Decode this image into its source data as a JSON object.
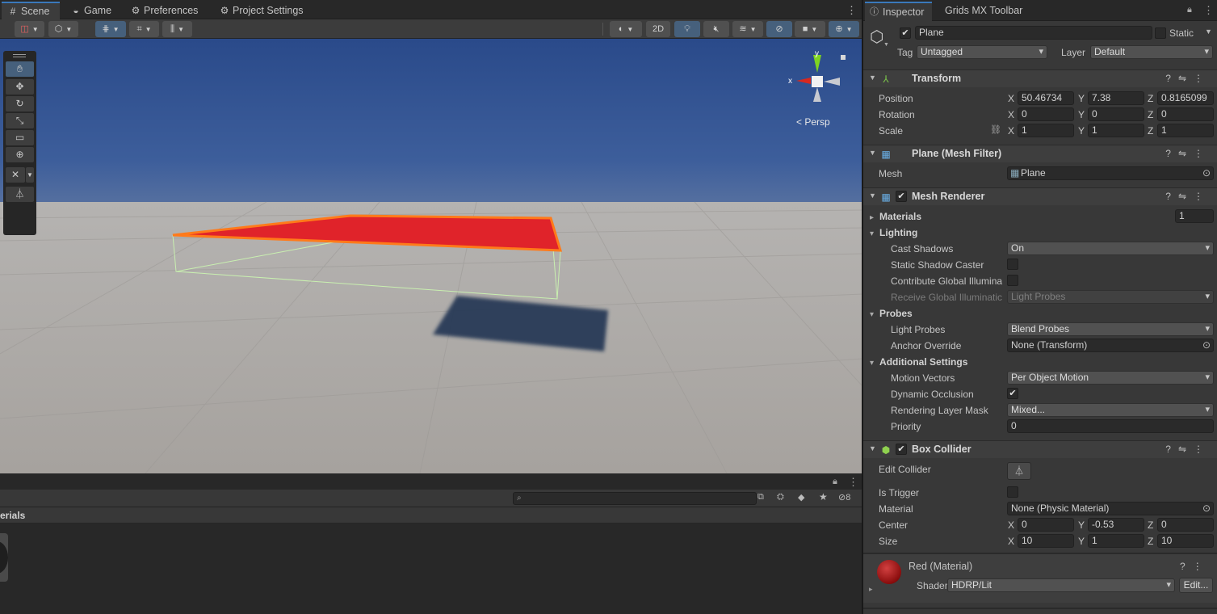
{
  "scene_tabs": [
    {
      "label": "Scene",
      "icon": "grid-icon"
    },
    {
      "label": "Game",
      "icon": "gamepad-icon"
    },
    {
      "label": "Preferences",
      "icon": "gear-icon"
    },
    {
      "label": "Project Settings",
      "icon": "gear-icon"
    }
  ],
  "scene_toolbar": {
    "two_d_label": "2D"
  },
  "scene_view": {
    "persp_label": "Persp",
    "gizmo": {
      "x": "x",
      "y": "y"
    }
  },
  "project_panel": {
    "search_placeholder": "",
    "breadcrumb": "erials",
    "hidden_count": "8"
  },
  "inspector": {
    "tabs": [
      "Inspector",
      "Grids MX Toolbar"
    ],
    "object": {
      "name": "Plane",
      "static_label": "Static",
      "active": true,
      "tag_label": "Tag",
      "tag_value": "Untagged",
      "layer_label": "Layer",
      "layer_value": "Default"
    },
    "transform": {
      "title": "Transform",
      "position_label": "Position",
      "position": {
        "x": "50.46734",
        "y": "7.38",
        "z": "0.8165099"
      },
      "rotation_label": "Rotation",
      "rotation": {
        "x": "0",
        "y": "0",
        "z": "0"
      },
      "scale_label": "Scale",
      "scale": {
        "x": "1",
        "y": "1",
        "z": "1"
      }
    },
    "mesh_filter": {
      "title": "Plane (Mesh Filter)",
      "mesh_label": "Mesh",
      "mesh_value": "Plane"
    },
    "mesh_renderer": {
      "title": "Mesh Renderer",
      "materials_label": "Materials",
      "materials_count": "1",
      "lighting_label": "Lighting",
      "cast_shadows_label": "Cast Shadows",
      "cast_shadows_value": "On",
      "static_shadow_label": "Static Shadow Caster",
      "contribute_gi_label": "Contribute Global Illumina",
      "receive_gi_label": "Receive Global Illuminatic",
      "receive_gi_value": "Light Probes",
      "probes_label": "Probes",
      "light_probes_label": "Light Probes",
      "light_probes_value": "Blend Probes",
      "anchor_label": "Anchor Override",
      "anchor_value": "None (Transform)",
      "additional_label": "Additional Settings",
      "motion_vectors_label": "Motion Vectors",
      "motion_vectors_value": "Per Object Motion",
      "dynamic_occlusion_label": "Dynamic Occlusion",
      "rendering_layer_label": "Rendering Layer Mask",
      "rendering_layer_value": "Mixed...",
      "priority_label": "Priority",
      "priority_value": "0"
    },
    "box_collider": {
      "title": "Box Collider",
      "edit_collider_label": "Edit Collider",
      "is_trigger_label": "Is Trigger",
      "material_label": "Material",
      "material_value": "None (Physic Material)",
      "center_label": "Center",
      "center": {
        "x": "0",
        "y": "-0.53",
        "z": "0"
      },
      "size_label": "Size",
      "size": {
        "x": "10",
        "y": "1",
        "z": "10"
      }
    },
    "material": {
      "title": "Red (Material)",
      "shader_label": "Shader",
      "shader_value": "HDRP/Lit",
      "edit_label": "Edit..."
    },
    "axis": {
      "x": "X",
      "y": "Y",
      "z": "Z"
    }
  },
  "colors": {
    "accent": "#3a79bb",
    "selection_fill": "#e0232a",
    "selection_outline": "#ff7a1a",
    "bounds": "#b8e6a0"
  }
}
